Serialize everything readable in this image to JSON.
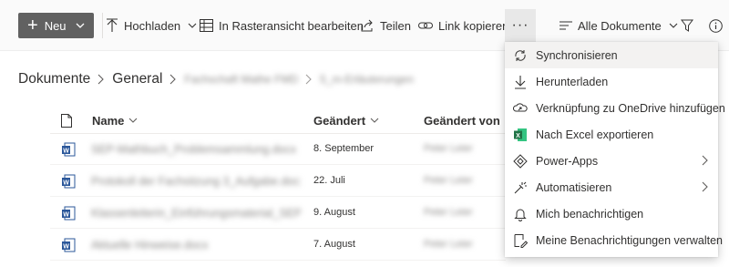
{
  "toolbar": {
    "new_label": "Neu",
    "upload_label": "Hochladen",
    "grid_edit_label": "In Rasteransicht bearbeiten",
    "share_label": "Teilen",
    "copy_link_label": "Link kopieren",
    "more_label": "···",
    "view_label": "Alle Dokumente"
  },
  "breadcrumb": {
    "root": "Dokumente",
    "level1": "General",
    "level2": "Fachschaft Mathe FMD",
    "level3": "5_m-Erläuterungen"
  },
  "table": {
    "headers": {
      "name": "Name",
      "modified": "Geändert",
      "modified_by": "Geändert von"
    },
    "rows": [
      {
        "name": "SEP-Mathbuch_Problemsammlung.docx",
        "date": "8. September",
        "by": "Peter Leier"
      },
      {
        "name": "Protokoll der Fachsitzung 3_Aufgabe.docx",
        "date": "22. Juli",
        "by": "Peter Leier"
      },
      {
        "name": "Klassenleiterin_Einführungsmaterial_SEP_Heft.docx",
        "date": "9. August",
        "by": "Peter Leier"
      },
      {
        "name": "Aktuelle Hinweise.docx",
        "date": "7. August",
        "by": "Peter Leier"
      }
    ]
  },
  "menu": {
    "items": [
      {
        "label": "Synchronisieren",
        "icon": "sync-icon"
      },
      {
        "label": "Herunterladen",
        "icon": "download-icon"
      },
      {
        "label": "Verknüpfung zu OneDrive hinzufügen",
        "icon": "onedrive-shortcut-icon"
      },
      {
        "label": "Nach Excel exportieren",
        "icon": "excel-icon"
      },
      {
        "label": "Power-Apps",
        "icon": "powerapps-icon"
      },
      {
        "label": "Automatisieren",
        "icon": "automate-icon"
      },
      {
        "label": "Mich benachrichtigen",
        "icon": "bell-icon"
      },
      {
        "label": "Meine Benachrichtigungen verwalten",
        "icon": "manage-alerts-icon"
      }
    ]
  },
  "colors": {
    "new_button_bg": "#616161",
    "word_blue": "#2b579a",
    "excel_green": "#217346",
    "menu_hover": "#f3f2f1"
  }
}
